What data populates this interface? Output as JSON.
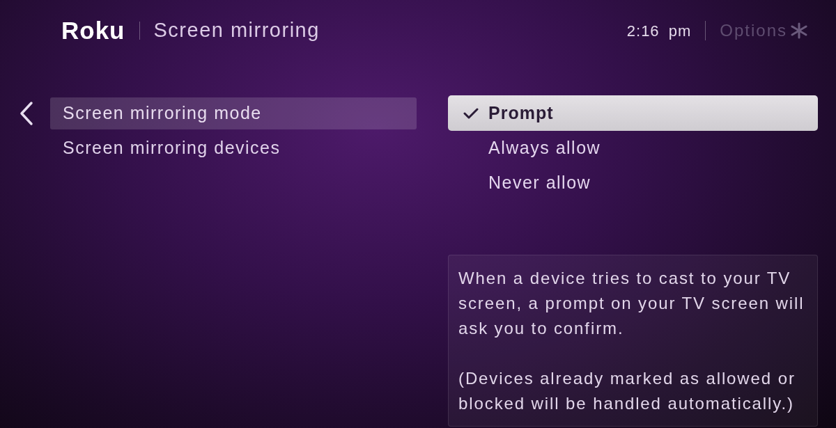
{
  "header": {
    "logo": "Roku",
    "title": "Screen mirroring",
    "time": "2:16 pm",
    "options_label": "Options"
  },
  "menu": {
    "items": [
      {
        "label": "Screen mirroring mode",
        "selected": true
      },
      {
        "label": "Screen mirroring devices",
        "selected": false
      }
    ]
  },
  "options": [
    {
      "label": "Prompt",
      "selected": true
    },
    {
      "label": "Always allow",
      "selected": false
    },
    {
      "label": "Never allow",
      "selected": false
    }
  ],
  "description": {
    "paragraphs": [
      "When a device tries to cast to your TV screen, a prompt on your TV screen will ask you to confirm.",
      "(Devices already marked as allowed or blocked will be handled automatically.)"
    ]
  }
}
